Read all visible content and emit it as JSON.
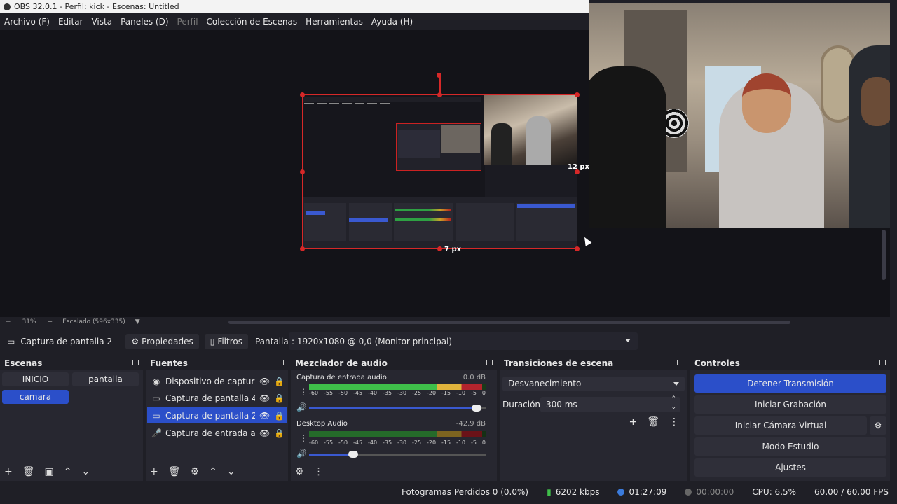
{
  "window": {
    "title": "OBS 32.0.1 - Perfil: kick - Escenas: Untitled"
  },
  "menu": [
    {
      "label": "Archivo (F)",
      "enabled": true
    },
    {
      "label": "Editar",
      "enabled": true
    },
    {
      "label": "Vista",
      "enabled": true
    },
    {
      "label": "Paneles (D)",
      "enabled": true
    },
    {
      "label": "Perfil",
      "enabled": false
    },
    {
      "label": "Colección de Escenas",
      "enabled": true
    },
    {
      "label": "Herramientas",
      "enabled": true
    },
    {
      "label": "Ayuda (H)",
      "enabled": true
    }
  ],
  "preview": {
    "right_offset": "12 px",
    "bottom_offset": "7 px"
  },
  "zoom": {
    "minus": "−",
    "percent": "31%",
    "plus": "+",
    "mode": "Escalado (596x335)"
  },
  "source_toolbar": {
    "selected_source": "Captura de pantalla 2",
    "properties_label": "Propiedades",
    "filters_label": "Filtros",
    "screen_label": "Pantalla",
    "screen_value": ": 1920x1080 @ 0,0 (Monitor principal)"
  },
  "scenes": {
    "title": "Escenas",
    "items": [
      {
        "label": "INICIO",
        "active": false
      },
      {
        "label": "pantalla",
        "active": false
      },
      {
        "label": "camara",
        "active": true
      }
    ]
  },
  "sources": {
    "title": "Fuentes",
    "items": [
      {
        "label": "Dispositivo de captura de",
        "icon": "camera-icon",
        "selected": false
      },
      {
        "label": "Captura de pantalla 4",
        "icon": "monitor-icon",
        "selected": false
      },
      {
        "label": "Captura de pantalla 2",
        "icon": "monitor-icon",
        "selected": true
      },
      {
        "label": "Captura de entrada audic",
        "icon": "microphone-icon",
        "selected": false
      }
    ]
  },
  "mixer": {
    "title": "Mezclador de audio",
    "scale": [
      "-60",
      "-55",
      "-50",
      "-45",
      "-40",
      "-35",
      "-30",
      "-25",
      "-20",
      "-15",
      "-10",
      "-5",
      "0"
    ],
    "channels": [
      {
        "name": "Captura de entrada audio",
        "db": "0.0 dB",
        "level": 0.98,
        "volume": 0.95
      },
      {
        "name": "Desktop Audio",
        "db": "-42.9 dB",
        "level": 0.98,
        "volume": 0.25
      }
    ]
  },
  "transitions": {
    "title": "Transiciones de escena",
    "selected": "Desvanecimiento",
    "duration_label": "Duración",
    "duration_value": "300 ms"
  },
  "controls": {
    "title": "Controles",
    "buttons": [
      {
        "label": "Detener Transmisión",
        "primary": true
      },
      {
        "label": "Iniciar Grabación",
        "primary": false
      },
      {
        "label": "Iniciar Cámara Virtual",
        "primary": false
      },
      {
        "label": "Modo Estudio",
        "primary": false
      },
      {
        "label": "Ajustes",
        "primary": false
      }
    ]
  },
  "status": {
    "dropped": "Fotogramas Perdidos 0 (0.0%)",
    "bitrate": "6202 kbps",
    "stream_time": "01:27:09",
    "record_time": "00:00:00",
    "cpu": "CPU: 6.5%",
    "fps": "60.00 / 60.00 FPS"
  },
  "colors": {
    "accent": "#2b4fc9",
    "selection_red": "#d62828",
    "meter_green": "#3fbf4a"
  }
}
